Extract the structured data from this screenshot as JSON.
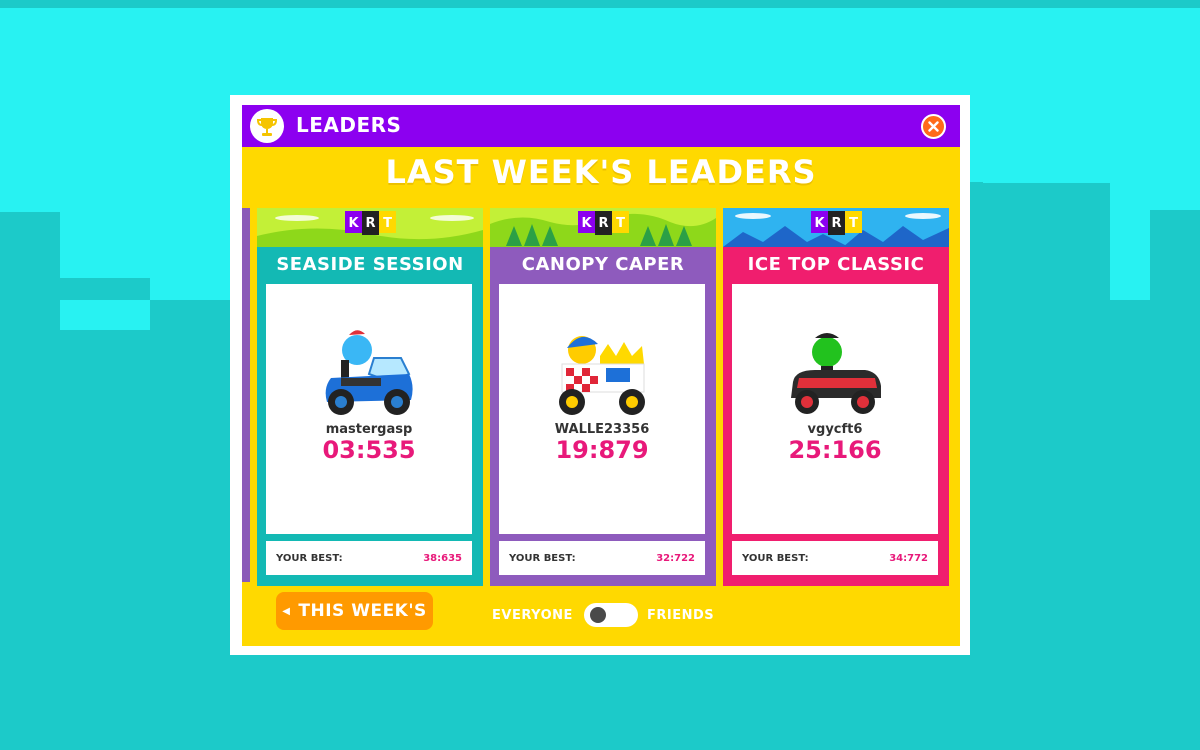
{
  "window": {
    "title": "LEADERS"
  },
  "heading": "LAST WEEK'S LEADERS",
  "logo_text": [
    "K",
    "R",
    "T"
  ],
  "cards": [
    {
      "track": "SEASIDE SESSION",
      "player": "mastergasp",
      "time": "03:535",
      "best_label": "YOUR BEST:",
      "best_time": "38:635",
      "color": "#13b9b4"
    },
    {
      "track": "CANOPY CAPER",
      "player": "WALLE23356",
      "time": "19:879",
      "best_label": "YOUR BEST:",
      "best_time": "32:722",
      "color": "#8e5bbd"
    },
    {
      "track": "ICE TOP CLASSIC",
      "player": "vgycft6",
      "time": "25:166",
      "best_label": "YOUR BEST:",
      "best_time": "34:772",
      "color": "#f01e6e"
    }
  ],
  "footer": {
    "this_week_label": "THIS WEEK'S",
    "toggle_left": "EVERYONE",
    "toggle_right": "FRIENDS",
    "toggle_state": "everyone"
  },
  "colors": {
    "title_bar": "#8c00f0",
    "modal_bg": "#ffd900",
    "time_pink": "#e8197a",
    "close": "#ff6a1a",
    "this_week_button": "#ff9a00",
    "background": "#1ccac9",
    "sky": "#28f2f2"
  },
  "icons": [
    "trophy-icon",
    "close-icon",
    "arrow-left-icon",
    "krt-logo"
  ]
}
